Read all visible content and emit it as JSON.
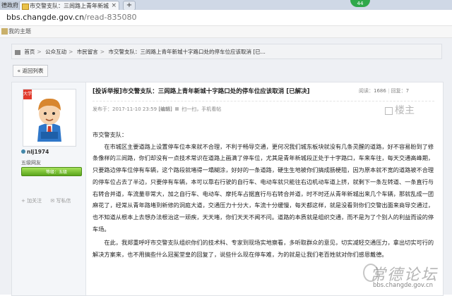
{
  "browser": {
    "tab1_label": "德政府",
    "tab2_label": "市交警支队：三闾路上青年新城",
    "new_tab": "+",
    "badge": "44",
    "url_domain": "bbs.changde.gov.cn",
    "url_path": "/read-835080",
    "bookmark": "我的主题"
  },
  "breadcrumb": {
    "items": [
      "首页",
      "公众互动",
      "市民留言",
      "市交警支队：三闾路上青年新城十字路口处的停车位应该取消 [已..."
    ],
    "sep": ">"
  },
  "back_button": "返回列表",
  "author": {
    "avatar_tag": "大学",
    "name": "nlj1974",
    "group": "五级网友",
    "level_label": "等级：五级",
    "actions": [
      "加关注",
      "写私信"
    ]
  },
  "post": {
    "title": "[投诉举报]市交警支队：三闾路上青年新城十字路口处的停车位应该取消 [已解决]",
    "views_label": "阅读：",
    "views": "1686",
    "replies_label": "回复：",
    "replies": "7",
    "meta_published": "发布于：2017-11-10 23:59",
    "meta_edit": "[编辑]",
    "meta_scan": "扫一扫，手机看帖",
    "floor_label": "楼主",
    "greeting": "市交警支队：",
    "para1": "在市城区主要道路上设置停车位本来就不合理，不利于畅导交通，更何况我们城东板块就没有几条灵醒的道路，好不容易盼到了修条像样的三闾路，你们却没有一点技术常识在道路上画满了停车位，尤其是青年新城段正处于十字路口，车来车往，每天交通高峰期，只要路边停车位停有车辆，这个路段就堵得一塌糊涂，好好的一条道路，硬生生地被你们搞成肠梗阻，因为原本就不宽的道路被不合理的停车位占去了半边，只要停有车辆，本可以靠右行驶的自行车、电动车就只能往右边机动车道上挤，就剩下一条左转道、一条直行与右转合并道，车流量非常大，加之自行车、电动车、摩托车占据直行与右转合并道，时不时还从青年新城出来几个车辆，那就乱成一团麻花了，经常从青年路堵到新修的洞庭大道，交通压力十分大，车流十分缓慢，每天都这样，就是没看到你们交警出面来商导交通过，也不知道从根本上去想办法根治这一顽疾，天天堵，你们天天不闻不问。道路的本质就是组织交通，而不是为了个别人的利益而设的停车场。",
    "para2": "在此，我郑重呼吁市交警支队组织你们的技术科、专家到现场实地察看，多听取群众的意见，切实减轻交通压力，拿出切实可行的解决方案来，也不用搞些什么冠冕堂皇的回复了，说些什么现在停车难，为的就是让我们老百姓就对你们感恩戴德。"
  },
  "watermark": {
    "title": "常德论坛",
    "url": "bbs.changde.gov.cn"
  }
}
